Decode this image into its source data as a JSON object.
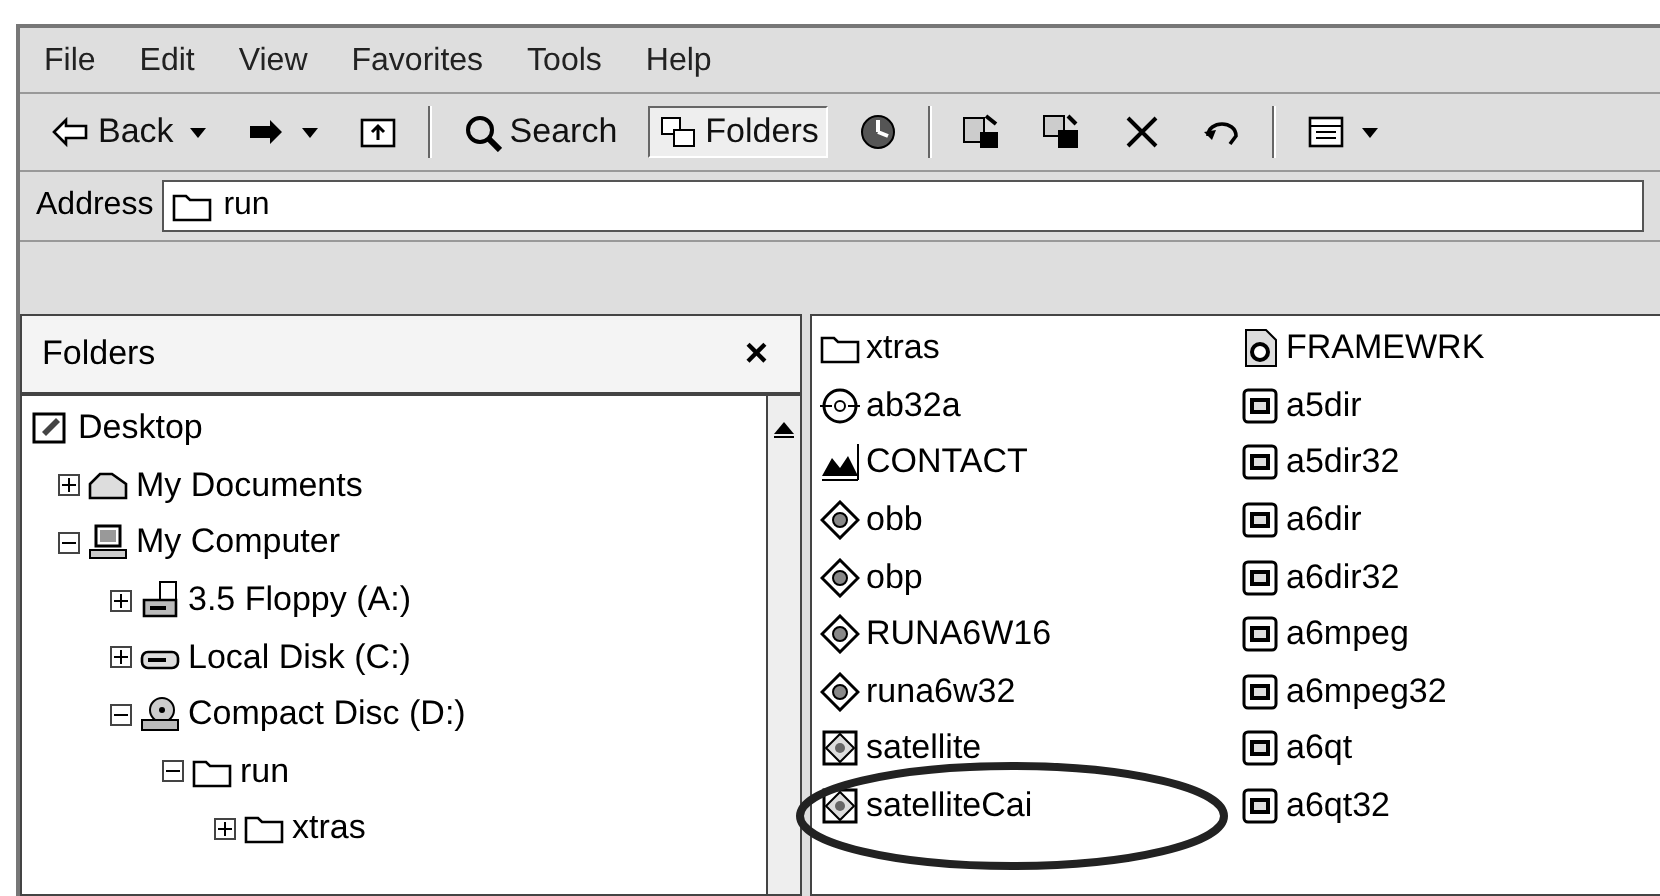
{
  "menu": [
    "File",
    "Edit",
    "View",
    "Favorites",
    "Tools",
    "Help"
  ],
  "toolbar": [
    {
      "kind": "back",
      "label": "Back",
      "selected": false
    },
    {
      "kind": "forward",
      "selected": false
    },
    {
      "kind": "up",
      "selected": false
    },
    {
      "kind": "separator"
    },
    {
      "kind": "search",
      "label": "Search",
      "selected": false
    },
    {
      "kind": "folders",
      "label": "Folders",
      "selected": true
    },
    {
      "kind": "history",
      "selected": false
    },
    {
      "kind": "separator"
    },
    {
      "kind": "move",
      "selected": false
    },
    {
      "kind": "copy",
      "selected": false
    },
    {
      "kind": "delete",
      "selected": false
    },
    {
      "kind": "undo",
      "selected": false
    },
    {
      "kind": "separator"
    },
    {
      "kind": "views",
      "selected": false
    }
  ],
  "address": {
    "label": "Address",
    "value": "run"
  },
  "folders_pane": {
    "title": "Folders",
    "close": "×",
    "tree": [
      {
        "label": "Desktop",
        "kind": "desktop",
        "children": [
          {
            "label": "My Documents",
            "kind": "documents",
            "expanded": false
          },
          {
            "label": "My Computer",
            "kind": "computer",
            "expanded": true,
            "children": [
              {
                "label": "3.5 Floppy (A:)",
                "kind": "floppy",
                "expanded": false
              },
              {
                "label": "Local Disk (C:)",
                "kind": "disk",
                "expanded": false
              },
              {
                "label": "Compact Disc (D:)",
                "kind": "cd",
                "expanded": true,
                "children": [
                  {
                    "label": "run",
                    "kind": "folder",
                    "expanded": true,
                    "children": [
                      {
                        "label": "xtras",
                        "kind": "folder",
                        "expanded": false
                      }
                    ]
                  }
                ]
              }
            ]
          }
        ]
      }
    ]
  },
  "files": [
    [
      {
        "name": "xtras",
        "kind": "folder"
      },
      {
        "name": "ab32a",
        "kind": "disc"
      },
      {
        "name": "CONTACT",
        "kind": "contact"
      },
      {
        "name": "obb",
        "kind": "diamond"
      },
      {
        "name": "obp",
        "kind": "diamond"
      },
      {
        "name": "RUNA6W16",
        "kind": "diamond"
      },
      {
        "name": "runa6w32",
        "kind": "diamond"
      },
      {
        "name": "satellite",
        "kind": "satellite"
      },
      {
        "name": "satelliteCai",
        "kind": "satellite"
      }
    ],
    [
      {
        "name": "FRAMEWRK",
        "kind": "gear"
      },
      {
        "name": "a5dir",
        "kind": "app"
      },
      {
        "name": "a5dir32",
        "kind": "app"
      },
      {
        "name": "a6dir",
        "kind": "app"
      },
      {
        "name": "a6dir32",
        "kind": "app"
      },
      {
        "name": "a6mpeg",
        "kind": "app"
      },
      {
        "name": "a6mpeg32",
        "kind": "app"
      },
      {
        "name": "a6qt",
        "kind": "app"
      },
      {
        "name": "a6qt32",
        "kind": "app"
      }
    ]
  ]
}
